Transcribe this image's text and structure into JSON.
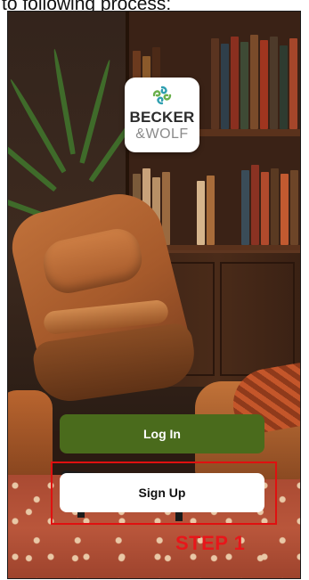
{
  "caption": {
    "text": "to following process:"
  },
  "logo": {
    "icon": "becker-wolf-swirl-icon",
    "brand_line1": "BECKER",
    "brand_line2": "&WOLF"
  },
  "buttons": {
    "login_label": "Log In",
    "signup_label": "Sign Up"
  },
  "annotation": {
    "step_label": "STEP 1"
  },
  "colors": {
    "login_button": "#4a6b1c",
    "signup_button": "#ffffff",
    "highlight": "#e01010",
    "step_text": "#e8161a"
  }
}
